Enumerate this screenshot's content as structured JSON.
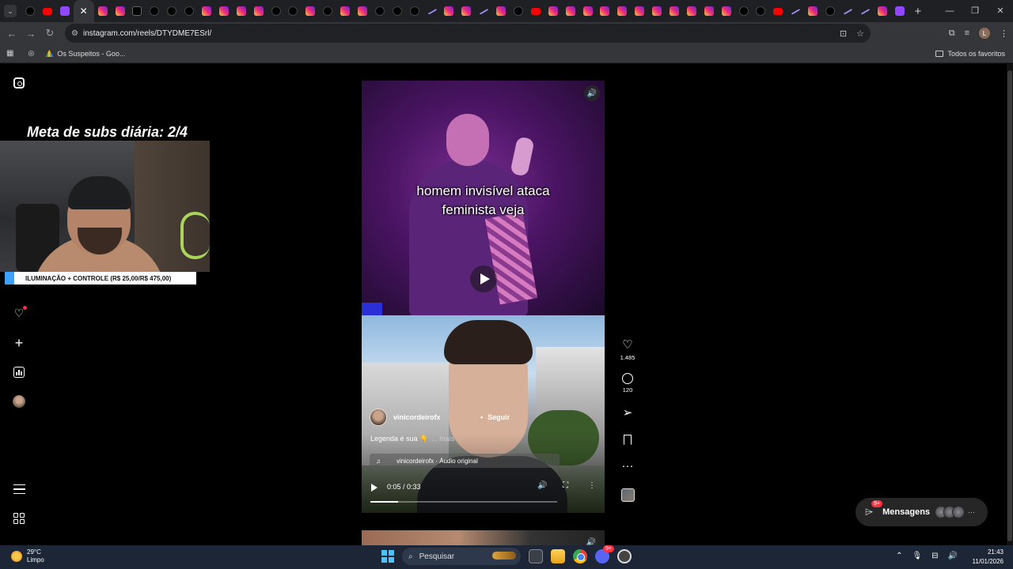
{
  "browser": {
    "tab_icons": [
      "tiktok",
      "youtube",
      "twitch",
      "close",
      "instagram",
      "instagram",
      "x",
      "tiktok",
      "tiktok",
      "tiktok",
      "instagram",
      "instagram",
      "instagram",
      "instagram",
      "tiktok",
      "tiktok",
      "instagram",
      "tiktok",
      "instagram",
      "instagram",
      "tiktok",
      "tiktok",
      "tiktok",
      "pen",
      "instagram",
      "instagram",
      "pen",
      "instagram",
      "tiktok",
      "youtube",
      "instagram",
      "instagram",
      "instagram",
      "instagram",
      "instagram",
      "instagram",
      "instagram",
      "instagram",
      "instagram",
      "instagram",
      "instagram",
      "tiktok",
      "tiktok",
      "youtube",
      "pen",
      "instagram",
      "tiktok",
      "pen",
      "pen",
      "instagram",
      "twitch"
    ],
    "url": "instagram.com/reels/DTYDME7ESrl/",
    "profile_initial": "L",
    "bookmarks": [
      {
        "label": "Os Suspeitos - Goo...",
        "icon": "drive-icon"
      }
    ],
    "all_bookmarks": "Todos os favoritos"
  },
  "overlay": {
    "goal_text": "Meta de subs diária: 2/4",
    "promo_text": "ILUMINAÇÃO + CONTROLE (R$ 25,00/R$ 475,00)",
    "promo_progress": 0.053
  },
  "reel_top": {
    "caption_line1": "homem invisível ataca",
    "caption_line2": "feminista veja"
  },
  "reel_main": {
    "author": "vinicordeirofx",
    "follow_label": "Seguir",
    "legend": "Legenda é sua 👇",
    "more_label": "... mais",
    "audio": "vinicordeirofx · Áudio original",
    "time": "0:05 / 0:33",
    "progress": 0.15
  },
  "actions": {
    "likes": "1.485",
    "comments": "120"
  },
  "messages": {
    "label": "Mensagens",
    "badge": "9+"
  },
  "taskbar": {
    "temperature": "29°C",
    "condition": "Limpo",
    "search_placeholder": "Pesquisar",
    "discord_badge": "9+",
    "time": "21:43",
    "date": "11/01/2026"
  },
  "colors": {
    "page_bg": "#000000",
    "chrome_bg": "#35363a",
    "taskbar_bg": "#1c2636",
    "notification_red": "#ff3040",
    "promo_accent": "#3ea0ff"
  }
}
